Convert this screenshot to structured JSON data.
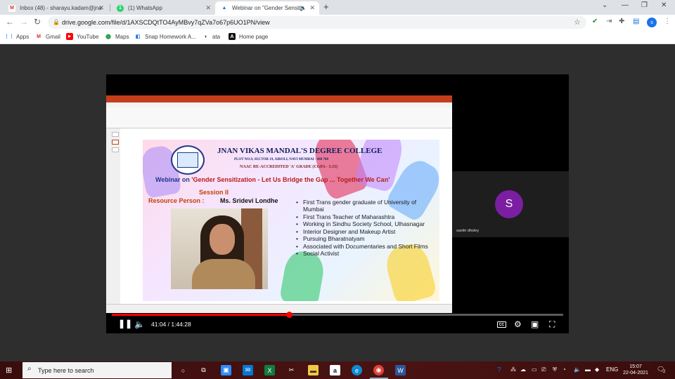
{
  "browser": {
    "tabs": [
      {
        "title": "Inbox (48) - sharayu.kadam@jna",
        "favicon": "gmail-icon",
        "color": "#d93025",
        "glyph": "M"
      },
      {
        "title": "(1) WhatsApp",
        "favicon": "whatsapp-icon",
        "color": "#25d366",
        "glyph": "1"
      },
      {
        "title": "Webinar on \"Gender Sensitiz",
        "favicon": "drive-icon",
        "color": "#1a73e8",
        "glyph": "▲",
        "audio": "🔊"
      }
    ],
    "url": "drive.google.com/file/d/1AXSCDQtTO4AyMBvy7qZVa7o67p6UO1PN/view",
    "profile_initial": "s",
    "bookmarks": [
      {
        "label": "Apps",
        "icon": "apps-grid-icon",
        "color": "#1a73e8",
        "glyph": "⋮⋮"
      },
      {
        "label": "Gmail",
        "icon": "gmail-icon",
        "color": "#d93025",
        "glyph": "M"
      },
      {
        "label": "YouTube",
        "icon": "youtube-icon",
        "color": "#ff0000",
        "glyph": "▶"
      },
      {
        "label": "Maps",
        "icon": "maps-icon",
        "color": "#34a853",
        "glyph": "●"
      },
      {
        "label": "Snap Homework A...",
        "icon": "snap-homework-icon",
        "color": "#1a73e8",
        "glyph": "◧"
      },
      {
        "label": "ata",
        "icon": "ata-icon",
        "color": "#222222",
        "glyph": "◑"
      },
      {
        "label": "Home page",
        "icon": "home-page-icon",
        "color": "#111111",
        "glyph": "A"
      }
    ]
  },
  "slide": {
    "college_name": "JNAN VIKAS MANDAL'S DEGREE COLLEGE",
    "college_address": "PLOT NO.9, SECTOR 19, AIROLI, NAVI MUMBAI - 400 708",
    "college_grade": "NAAC RE-ACCREDITED 'A' GRADE (CGPA - 3.33)",
    "webinar_prefix": "Webinar on ",
    "webinar_topic": "'Gender Sensitization - Let Us Bridge the Gap ... Together We Can'",
    "session": "Session II",
    "resource_label": "Resource Person :",
    "resource_name": "Ms. Sridevi Londhe",
    "bullets": [
      "First Trans gender graduate of University of Mumbai",
      "First Trans Teacher of Maharashtra",
      "Working in Sindhu Society School, Ulhasnagar",
      "Interior Designer and Makeup Artist",
      "Pursuing  Bharatnatyam",
      "Associated with Documentaries and Short Films",
      "Social Activist"
    ]
  },
  "participant": {
    "initial": "S",
    "name": "savitri dholey",
    "avatar_color": "#7b1fa2"
  },
  "player": {
    "time": "41:04 / 1:44:28",
    "progress_fraction": 0.393,
    "cc_label": "CC"
  },
  "taskbar": {
    "search_placeholder": "Type here to search",
    "lang": "ENG",
    "time": "15:07",
    "date": "22-04-2021",
    "notification_count": "2",
    "apps": [
      {
        "name": "cortana-icon",
        "glyph": "○",
        "color": "transparent"
      },
      {
        "name": "task-view-icon",
        "glyph": "⧉",
        "color": "transparent"
      },
      {
        "name": "zoom-icon",
        "glyph": "▣",
        "color": "#2d8cff"
      },
      {
        "name": "mail-icon",
        "glyph": "✉",
        "color": "#0078d4"
      },
      {
        "name": "excel-icon",
        "glyph": "X",
        "color": "#107c41"
      },
      {
        "name": "snipping-tool-icon",
        "glyph": "✂",
        "color": "transparent"
      },
      {
        "name": "file-explorer-icon",
        "glyph": "▬",
        "color": "#f2c744"
      },
      {
        "name": "amazon-icon",
        "glyph": "a",
        "color": "#ffffff"
      },
      {
        "name": "edge-icon",
        "glyph": "e",
        "color": "#0c8bd4"
      },
      {
        "name": "chrome-icon",
        "glyph": "◉",
        "color": "#db4437"
      },
      {
        "name": "word-icon",
        "glyph": "W",
        "color": "#2b579a"
      }
    ]
  }
}
